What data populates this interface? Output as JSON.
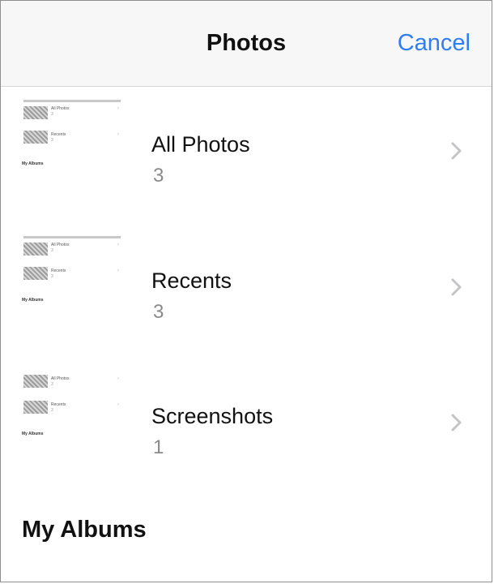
{
  "nav": {
    "title": "Photos",
    "cancel_label": "Cancel"
  },
  "albums": [
    {
      "title": "All Photos",
      "count": "3"
    },
    {
      "title": "Recents",
      "count": "3"
    },
    {
      "title": "Screenshots",
      "count": "1"
    }
  ],
  "thumbnail": {
    "item1_label": "All Photos",
    "item1_count": "3",
    "item2_label": "Recents",
    "item2_count": "3",
    "section_label": "My Albums"
  },
  "section": {
    "title": "My Albums"
  },
  "colors": {
    "accent": "#2f7ef2",
    "nav_bg": "#f7f7f7",
    "secondary_text": "#8a8a8a"
  },
  "icons": {
    "disclosure": "chevron-right-icon"
  }
}
